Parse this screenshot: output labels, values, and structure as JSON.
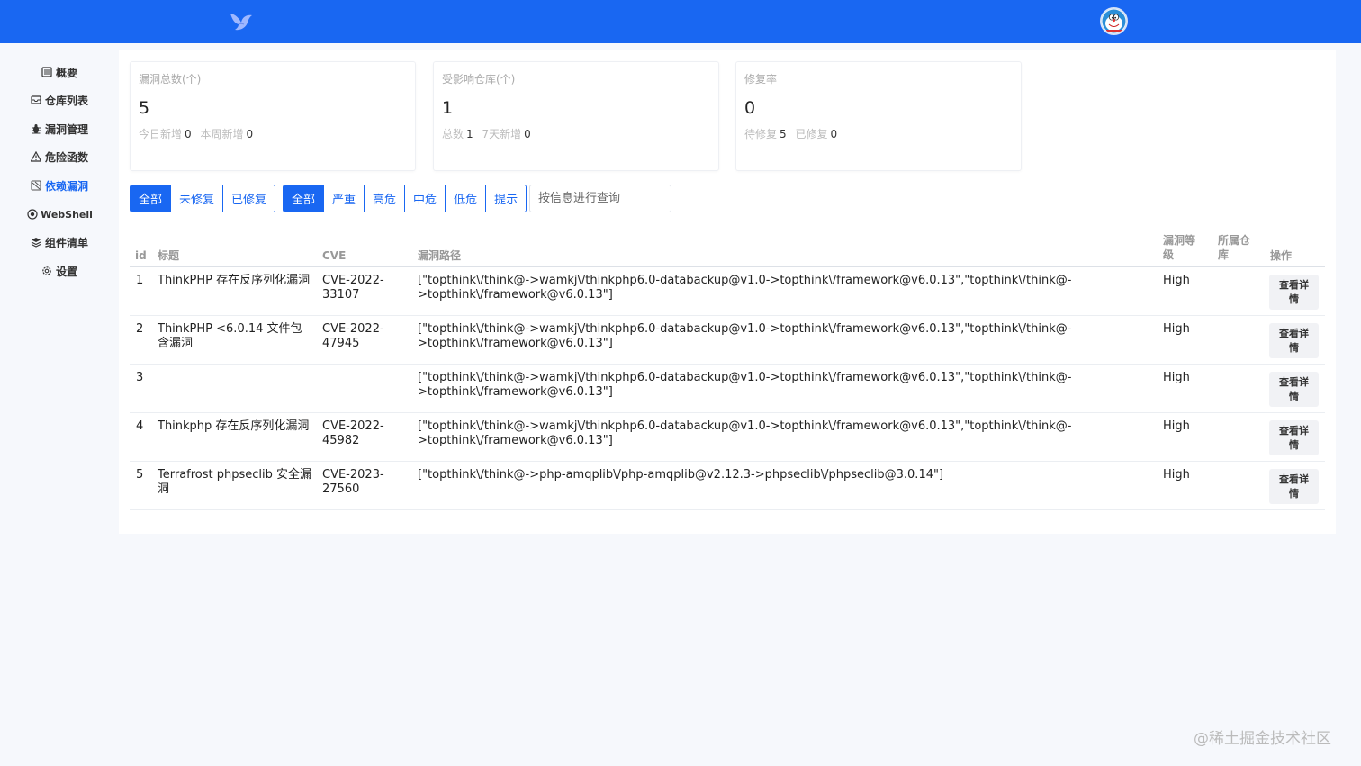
{
  "colors": {
    "primary": "#1967f2",
    "background": "#f6f8fc"
  },
  "header": {
    "logo_icon": "bird-logo-icon",
    "avatar_icon": "doraemon-avatar"
  },
  "sidebar": {
    "items": [
      {
        "label": "概要",
        "icon": "overview-icon"
      },
      {
        "label": "仓库列表",
        "icon": "inbox-icon"
      },
      {
        "label": "漏洞管理",
        "icon": "bug-icon"
      },
      {
        "label": "危险函数",
        "icon": "warning-icon"
      },
      {
        "label": "依赖漏洞",
        "icon": "dependency-icon",
        "active": true
      },
      {
        "label": "WebShell",
        "icon": "webshell-icon"
      },
      {
        "label": "组件清单",
        "icon": "layers-icon"
      },
      {
        "label": "设置",
        "icon": "gear-icon"
      }
    ]
  },
  "stats": [
    {
      "title": "漏洞总数(个)",
      "value": "5",
      "sub1_label": "今日新增",
      "sub1_value": "0",
      "sub2_label": "本周新增",
      "sub2_value": "0"
    },
    {
      "title": "受影响仓库(个)",
      "value": "1",
      "sub1_label": "总数",
      "sub1_value": "1",
      "sub2_label": "7天新增",
      "sub2_value": "0"
    },
    {
      "title": "修复率",
      "value": "0",
      "sub1_label": "待修复",
      "sub1_value": "5",
      "sub2_label": "已修复",
      "sub2_value": "0"
    }
  ],
  "filters": {
    "status": [
      "全部",
      "未修复",
      "已修复"
    ],
    "severity": [
      "全部",
      "严重",
      "高危",
      "中危",
      "低危",
      "提示"
    ],
    "search_placeholder": "按信息进行查询"
  },
  "table": {
    "headers": {
      "id": "id",
      "title": "标题",
      "cve": "CVE",
      "path": "漏洞路径",
      "level_l1": "漏洞等",
      "level_l2": "级",
      "repo_l1": "所属仓",
      "repo_l2": "库",
      "action": "操作"
    },
    "detail_label": "查看详情",
    "rows": [
      {
        "id": "1",
        "title": "ThinkPHP 存在反序列化漏洞",
        "cve": "CVE-2022-33107",
        "path_l1": "[\"topthink\\/think@->wamkj\\/thinkphp6.0-databackup@v1.0->topthink\\/framework@v6.0.13\",\"topthink\\/think@-",
        "path_l2": ">topthink\\/framework@v6.0.13\"]",
        "level": "High",
        "repo": ""
      },
      {
        "id": "2",
        "title": "ThinkPHP <6.0.14 文件包含漏洞",
        "cve": "CVE-2022-47945",
        "path_l1": "[\"topthink\\/think@->wamkj\\/thinkphp6.0-databackup@v1.0->topthink\\/framework@v6.0.13\",\"topthink\\/think@-",
        "path_l2": ">topthink\\/framework@v6.0.13\"]",
        "level": "High",
        "repo": ""
      },
      {
        "id": "3",
        "title": "",
        "cve": "",
        "path_l1": "[\"topthink\\/think@->wamkj\\/thinkphp6.0-databackup@v1.0->topthink\\/framework@v6.0.13\",\"topthink\\/think@-",
        "path_l2": ">topthink\\/framework@v6.0.13\"]",
        "level": "High",
        "repo": ""
      },
      {
        "id": "4",
        "title": "Thinkphp 存在反序列化漏洞",
        "cve": "CVE-2022-45982",
        "path_l1": "[\"topthink\\/think@->wamkj\\/thinkphp6.0-databackup@v1.0->topthink\\/framework@v6.0.13\",\"topthink\\/think@-",
        "path_l2": ">topthink\\/framework@v6.0.13\"]",
        "level": "High",
        "repo": ""
      },
      {
        "id": "5",
        "title": "Terrafrost phpseclib 安全漏洞",
        "cve": "CVE-2023-27560",
        "path_l1": "[\"topthink\\/think@->php-amqplib\\/php-amqplib@v2.12.3->phpseclib\\/phpseclib@3.0.14\"]",
        "path_l2": "",
        "level": "High",
        "repo": ""
      }
    ]
  },
  "watermark": "@稀土掘金技术社区"
}
